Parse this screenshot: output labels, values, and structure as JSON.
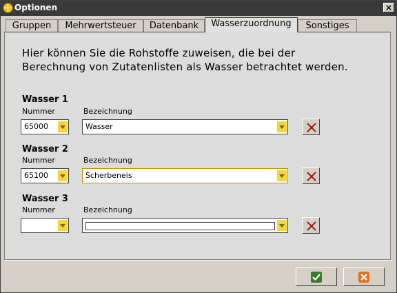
{
  "window": {
    "title": "Optionen",
    "close_glyph": "×"
  },
  "tabs": [
    {
      "label": "Gruppen",
      "active": false
    },
    {
      "label": "Mehrwertsteuer",
      "active": false
    },
    {
      "label": "Datenbank",
      "active": false
    },
    {
      "label": "Wasserzuordnung",
      "active": true
    },
    {
      "label": "Sonstiges",
      "active": false
    }
  ],
  "intro": {
    "line1": "Hier können Sie die Rohstoffe zuweisen, die bei der",
    "line2": "Berechnung von Zutatenlisten als Wasser betrachtet werden."
  },
  "groups": [
    {
      "title": "Wasser 1",
      "nummer_label": "Nummer",
      "bez_label": "Bezeichnung",
      "nummer": "65000",
      "bezeichnung": "Wasser"
    },
    {
      "title": "Wasser 2",
      "nummer_label": "Nummer",
      "bez_label": "Bezeichnung",
      "nummer": "65100",
      "bezeichnung": "Scherbeneis"
    },
    {
      "title": "Wasser 3",
      "nummer_label": "Nummer",
      "bez_label": "Bezeichnung",
      "nummer": "",
      "bezeichnung": ""
    }
  ],
  "icons": {
    "delete": "delete-x-icon",
    "ok": "checkmark-icon",
    "cancel": "cancel-icon",
    "dropdown": "chevron-down-icon"
  },
  "colors": {
    "dropdown_arrow": "#f0d838",
    "delete_x": "#a01818",
    "ok_green": "#3c7a2a",
    "cancel_orange": "#e0701c"
  }
}
